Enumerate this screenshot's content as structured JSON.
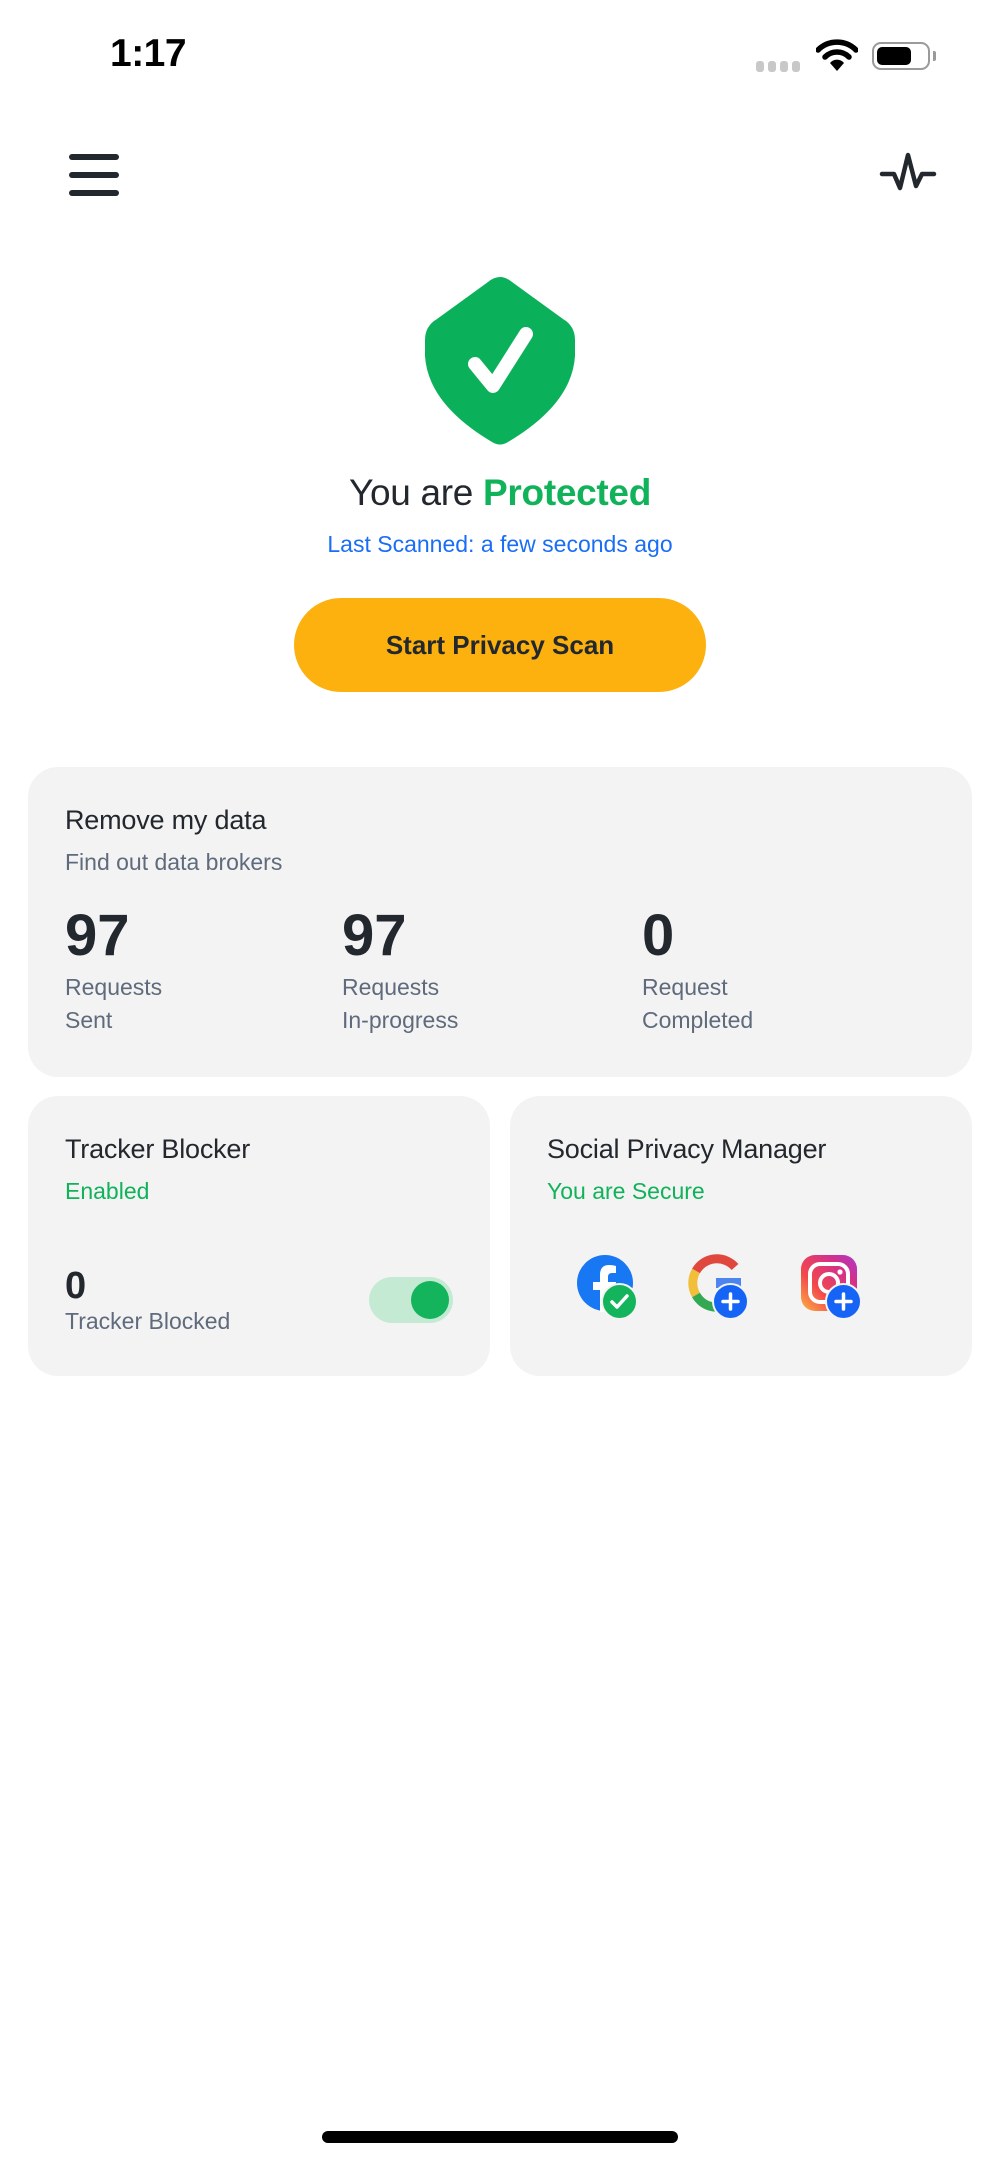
{
  "status_bar": {
    "time": "1:17",
    "signal_icon": "cellular-signal-icon",
    "wifi_icon": "wifi-icon",
    "battery_icon": "battery-icon",
    "battery_level": 0.7
  },
  "header": {
    "menu_icon": "hamburger-menu-icon",
    "activity_icon": "pulse-activity-icon"
  },
  "hero": {
    "shield_icon": "shield-check-icon",
    "headline_prefix": "You are ",
    "headline_status": "Protected",
    "last_scanned": "Last Scanned: a few seconds ago",
    "scan_button_label": "Start Privacy Scan"
  },
  "remove_data": {
    "title": "Remove my data",
    "subtitle": "Find out data brokers",
    "stats": [
      {
        "value": "97",
        "label_line1": "Requests",
        "label_line2": "Sent"
      },
      {
        "value": "97",
        "label_line1": "Requests",
        "label_line2": "In-progress"
      },
      {
        "value": "0",
        "label_line1": "Request",
        "label_line2": "Completed"
      }
    ]
  },
  "tracker_blocker": {
    "title": "Tracker Blocker",
    "status": "Enabled",
    "count": "0",
    "count_label": "Tracker Blocked",
    "toggle_on": true
  },
  "social_privacy": {
    "title": "Social Privacy Manager",
    "status": "You are Secure",
    "accounts": [
      {
        "name": "Facebook",
        "icon": "facebook-icon",
        "badge": "check",
        "badge_color": "#13b45c"
      },
      {
        "name": "Google",
        "icon": "google-icon",
        "badge": "plus",
        "badge_color": "#1664f5"
      },
      {
        "name": "Instagram",
        "icon": "instagram-icon",
        "badge": "plus",
        "badge_color": "#1664f5"
      }
    ]
  },
  "colors": {
    "accent_green": "#10b25a",
    "link_blue": "#1a6ef5",
    "button_yellow": "#fdb10f",
    "card_bg": "#f3f3f3",
    "text_dark": "#23272e",
    "text_muted": "#5f6b7c"
  }
}
